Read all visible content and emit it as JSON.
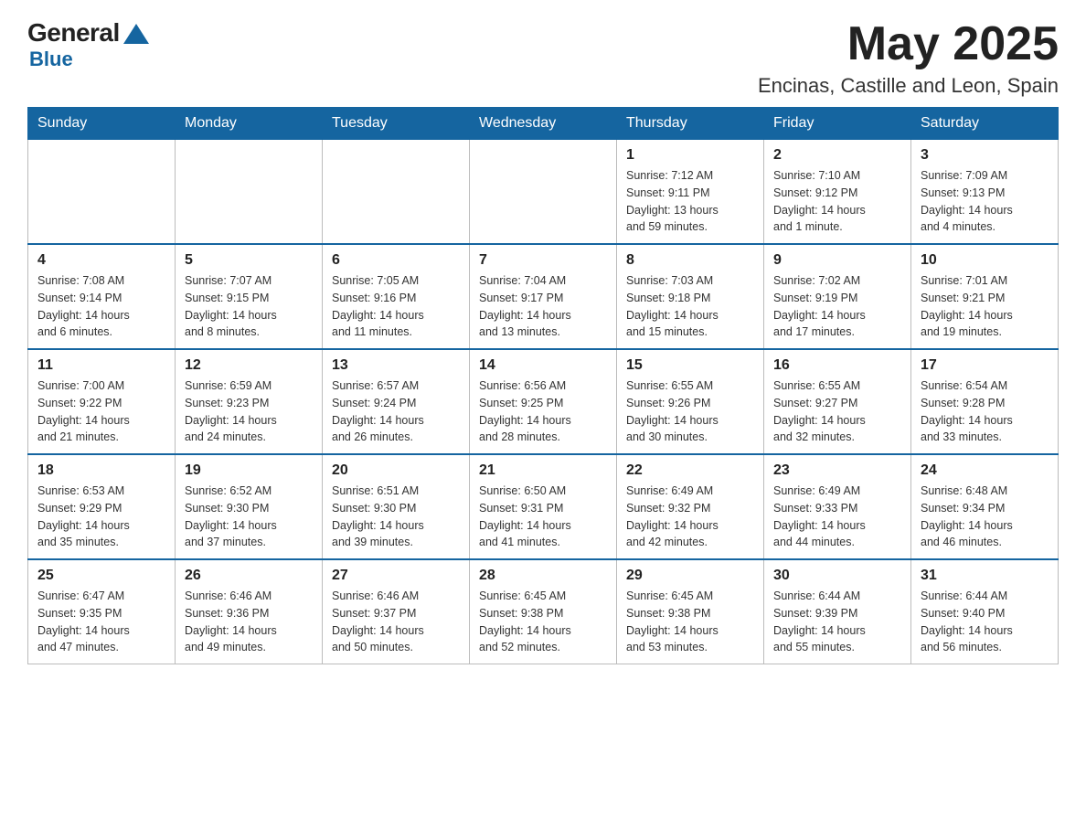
{
  "header": {
    "logo_general": "General",
    "logo_blue": "Blue",
    "month_title": "May 2025",
    "location": "Encinas, Castille and Leon, Spain"
  },
  "days_of_week": [
    "Sunday",
    "Monday",
    "Tuesday",
    "Wednesday",
    "Thursday",
    "Friday",
    "Saturday"
  ],
  "weeks": [
    [
      {
        "day": "",
        "info": ""
      },
      {
        "day": "",
        "info": ""
      },
      {
        "day": "",
        "info": ""
      },
      {
        "day": "",
        "info": ""
      },
      {
        "day": "1",
        "info": "Sunrise: 7:12 AM\nSunset: 9:11 PM\nDaylight: 13 hours\nand 59 minutes."
      },
      {
        "day": "2",
        "info": "Sunrise: 7:10 AM\nSunset: 9:12 PM\nDaylight: 14 hours\nand 1 minute."
      },
      {
        "day": "3",
        "info": "Sunrise: 7:09 AM\nSunset: 9:13 PM\nDaylight: 14 hours\nand 4 minutes."
      }
    ],
    [
      {
        "day": "4",
        "info": "Sunrise: 7:08 AM\nSunset: 9:14 PM\nDaylight: 14 hours\nand 6 minutes."
      },
      {
        "day": "5",
        "info": "Sunrise: 7:07 AM\nSunset: 9:15 PM\nDaylight: 14 hours\nand 8 minutes."
      },
      {
        "day": "6",
        "info": "Sunrise: 7:05 AM\nSunset: 9:16 PM\nDaylight: 14 hours\nand 11 minutes."
      },
      {
        "day": "7",
        "info": "Sunrise: 7:04 AM\nSunset: 9:17 PM\nDaylight: 14 hours\nand 13 minutes."
      },
      {
        "day": "8",
        "info": "Sunrise: 7:03 AM\nSunset: 9:18 PM\nDaylight: 14 hours\nand 15 minutes."
      },
      {
        "day": "9",
        "info": "Sunrise: 7:02 AM\nSunset: 9:19 PM\nDaylight: 14 hours\nand 17 minutes."
      },
      {
        "day": "10",
        "info": "Sunrise: 7:01 AM\nSunset: 9:21 PM\nDaylight: 14 hours\nand 19 minutes."
      }
    ],
    [
      {
        "day": "11",
        "info": "Sunrise: 7:00 AM\nSunset: 9:22 PM\nDaylight: 14 hours\nand 21 minutes."
      },
      {
        "day": "12",
        "info": "Sunrise: 6:59 AM\nSunset: 9:23 PM\nDaylight: 14 hours\nand 24 minutes."
      },
      {
        "day": "13",
        "info": "Sunrise: 6:57 AM\nSunset: 9:24 PM\nDaylight: 14 hours\nand 26 minutes."
      },
      {
        "day": "14",
        "info": "Sunrise: 6:56 AM\nSunset: 9:25 PM\nDaylight: 14 hours\nand 28 minutes."
      },
      {
        "day": "15",
        "info": "Sunrise: 6:55 AM\nSunset: 9:26 PM\nDaylight: 14 hours\nand 30 minutes."
      },
      {
        "day": "16",
        "info": "Sunrise: 6:55 AM\nSunset: 9:27 PM\nDaylight: 14 hours\nand 32 minutes."
      },
      {
        "day": "17",
        "info": "Sunrise: 6:54 AM\nSunset: 9:28 PM\nDaylight: 14 hours\nand 33 minutes."
      }
    ],
    [
      {
        "day": "18",
        "info": "Sunrise: 6:53 AM\nSunset: 9:29 PM\nDaylight: 14 hours\nand 35 minutes."
      },
      {
        "day": "19",
        "info": "Sunrise: 6:52 AM\nSunset: 9:30 PM\nDaylight: 14 hours\nand 37 minutes."
      },
      {
        "day": "20",
        "info": "Sunrise: 6:51 AM\nSunset: 9:30 PM\nDaylight: 14 hours\nand 39 minutes."
      },
      {
        "day": "21",
        "info": "Sunrise: 6:50 AM\nSunset: 9:31 PM\nDaylight: 14 hours\nand 41 minutes."
      },
      {
        "day": "22",
        "info": "Sunrise: 6:49 AM\nSunset: 9:32 PM\nDaylight: 14 hours\nand 42 minutes."
      },
      {
        "day": "23",
        "info": "Sunrise: 6:49 AM\nSunset: 9:33 PM\nDaylight: 14 hours\nand 44 minutes."
      },
      {
        "day": "24",
        "info": "Sunrise: 6:48 AM\nSunset: 9:34 PM\nDaylight: 14 hours\nand 46 minutes."
      }
    ],
    [
      {
        "day": "25",
        "info": "Sunrise: 6:47 AM\nSunset: 9:35 PM\nDaylight: 14 hours\nand 47 minutes."
      },
      {
        "day": "26",
        "info": "Sunrise: 6:46 AM\nSunset: 9:36 PM\nDaylight: 14 hours\nand 49 minutes."
      },
      {
        "day": "27",
        "info": "Sunrise: 6:46 AM\nSunset: 9:37 PM\nDaylight: 14 hours\nand 50 minutes."
      },
      {
        "day": "28",
        "info": "Sunrise: 6:45 AM\nSunset: 9:38 PM\nDaylight: 14 hours\nand 52 minutes."
      },
      {
        "day": "29",
        "info": "Sunrise: 6:45 AM\nSunset: 9:38 PM\nDaylight: 14 hours\nand 53 minutes."
      },
      {
        "day": "30",
        "info": "Sunrise: 6:44 AM\nSunset: 9:39 PM\nDaylight: 14 hours\nand 55 minutes."
      },
      {
        "day": "31",
        "info": "Sunrise: 6:44 AM\nSunset: 9:40 PM\nDaylight: 14 hours\nand 56 minutes."
      }
    ]
  ]
}
